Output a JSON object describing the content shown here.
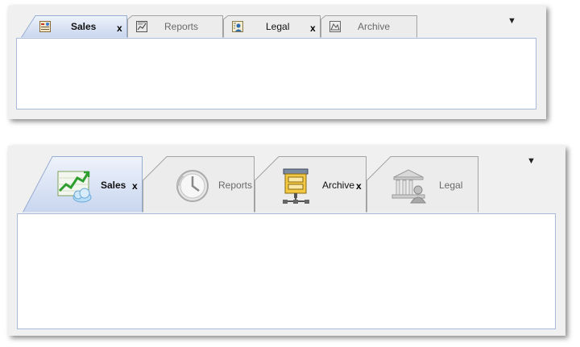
{
  "small_tabs": {
    "tabs": [
      {
        "label": "Sales",
        "icon": "sales-small-icon",
        "active": true,
        "closable": true
      },
      {
        "label": "Reports",
        "icon": "report-small-icon",
        "active": false,
        "closable": false
      },
      {
        "label": "Legal",
        "icon": "contact-card-icon",
        "active": false,
        "closable": true
      },
      {
        "label": "Archive",
        "icon": "archive-small-icon",
        "active": false,
        "closable": false
      }
    ],
    "close_glyph": "x",
    "menu_glyph": "▼"
  },
  "large_tabs": {
    "tabs": [
      {
        "label": "Sales",
        "icon": "sales-chart-cloud-icon",
        "active": true,
        "closable": true
      },
      {
        "label": "Reports",
        "icon": "clock-icon",
        "active": false,
        "closable": false
      },
      {
        "label": "Archive",
        "icon": "zip-archive-icon",
        "active": false,
        "closable": true
      },
      {
        "label": "Legal",
        "icon": "courthouse-user-icon",
        "active": false,
        "closable": false
      }
    ],
    "close_glyph": "x",
    "menu_glyph": "▼"
  },
  "colors": {
    "active_tab": "#c9d6ef",
    "content_border": "#a9bbd8",
    "panel_bg": "#f0f0f0"
  }
}
